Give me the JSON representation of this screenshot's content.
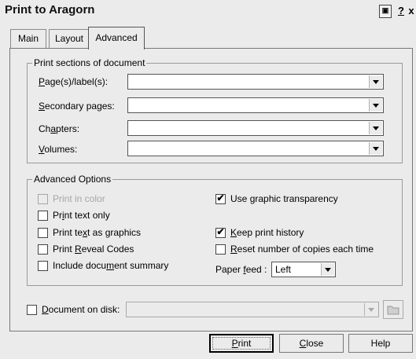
{
  "window": {
    "title": "Print to Aragorn",
    "help_label": "?",
    "close_label": "x"
  },
  "tabs": [
    {
      "label": "Main",
      "active": false
    },
    {
      "label": "Layout",
      "active": false
    },
    {
      "label": "Advanced",
      "active": true
    }
  ],
  "sections_group": {
    "title": "Print sections of document",
    "fields": [
      {
        "label": "Page(s)/label(s):",
        "mnemonic": "P",
        "rest": "age(s)/label(s):",
        "value": ""
      },
      {
        "label": "Secondary pages:",
        "mnemonic": "S",
        "rest": "econdary pages:",
        "value": ""
      },
      {
        "label": "Chapters:",
        "pre": "Ch",
        "mnemonic": "a",
        "rest": "pters:",
        "value": ""
      },
      {
        "label": "Volumes:",
        "mnemonic": "V",
        "rest": "olumes:",
        "value": ""
      }
    ]
  },
  "advanced_group": {
    "title": "Advanced Options",
    "left_options": [
      {
        "label": "Print in color",
        "checked": false,
        "disabled": true
      },
      {
        "label": "Print text only",
        "pre": "Pr",
        "mnemonic": "i",
        "rest": "nt text only",
        "checked": false,
        "disabled": false
      },
      {
        "label": "Print text as graphics",
        "pre": "Print te",
        "mnemonic": "x",
        "rest": "t as graphics",
        "checked": false,
        "disabled": false
      },
      {
        "label": "Print Reveal Codes",
        "pre": "Print ",
        "mnemonic": "R",
        "rest": "eveal Codes",
        "checked": false,
        "disabled": false
      },
      {
        "label": "Include document summary",
        "pre": "Include docu",
        "mnemonic": "m",
        "rest": "ent summary",
        "checked": false,
        "disabled": false
      }
    ],
    "right_options": [
      {
        "label": "Use graphic transparency",
        "pre": "Use ",
        "mnemonic": "g",
        "rest": "raphic transparency",
        "checked": true
      },
      {
        "label": "Keep print history",
        "pre": "",
        "mnemonic": "K",
        "rest": "eep print history",
        "checked": true
      },
      {
        "label": "Reset number of copies each time",
        "pre": "",
        "mnemonic": "R",
        "rest": "eset number of copies each time",
        "checked": false
      }
    ],
    "paper_feed": {
      "label": "Paper feed :",
      "pre": "Paper ",
      "mnemonic": "f",
      "rest": "eed :",
      "value": "Left"
    }
  },
  "document_on_disk": {
    "label": "Document on disk:",
    "pre": "",
    "mnemonic": "D",
    "rest": "ocument on disk:",
    "checked": false,
    "value": ""
  },
  "buttons": {
    "print": {
      "label": "Print",
      "mnemonic": "P",
      "rest": "rint"
    },
    "close": {
      "label": "Close",
      "mnemonic": "C",
      "rest": "lose"
    },
    "help": {
      "label": "Help"
    }
  },
  "icons": {
    "window_button": "print-preview-icon",
    "folder": "folder-icon",
    "dropdown": "chevron-down-icon",
    "check": "checkmark-icon"
  }
}
